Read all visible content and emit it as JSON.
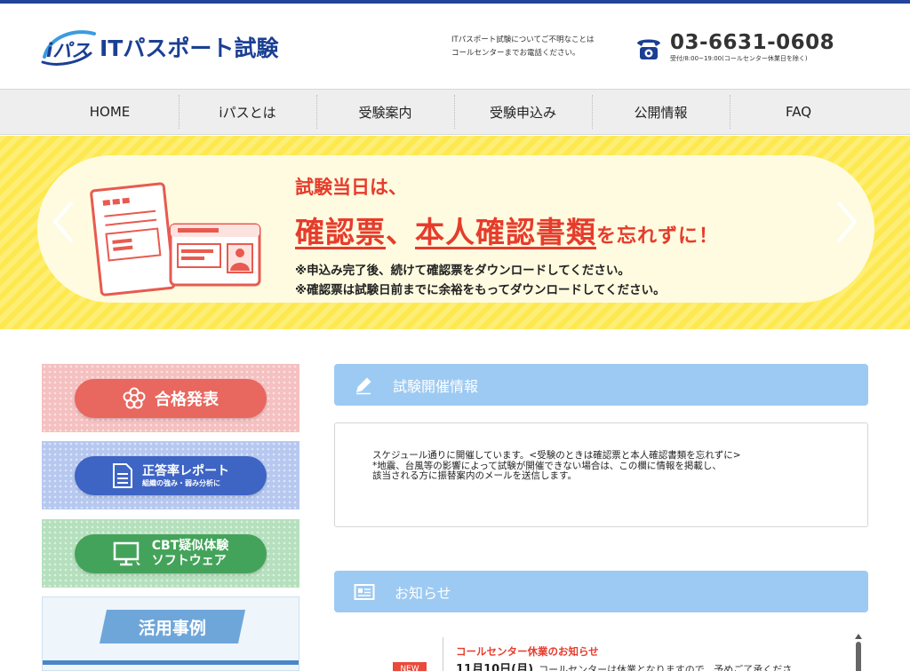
{
  "header": {
    "logo_mark": "iパス",
    "logo_title": "ITパスポート試験",
    "note_lines": [
      "ITパスポート試験についてご不明なことは",
      "コールセンターまでお電話ください。"
    ],
    "tel_number": "03-6631-0608",
    "tel_hours": "受付/8:00~19:00(コールセンター休業日を除く)"
  },
  "nav": {
    "items": [
      {
        "label": "HOME"
      },
      {
        "label": "iパスとは"
      },
      {
        "label": "受験案内"
      },
      {
        "label": "受験申込み"
      },
      {
        "label": "公開情報"
      },
      {
        "label": "FAQ"
      }
    ]
  },
  "banner": {
    "line1": "試験当日は、",
    "big1": "確認票",
    "sep": "、",
    "big2": "本人確認書類",
    "small": "を忘れずに！",
    "note1": "※申込み完了後、続けて確認票をダウンロードしてください。",
    "note2": "※確認票は試験日前までに余裕をもってダウンロードしてください。"
  },
  "sidebar": {
    "results": "合格発表",
    "report_main": "正答率レポート",
    "report_sub": "組織の強み・弱み分析に",
    "cbt_main": "CBT疑似体験",
    "cbt_sub": "ソフトウェア",
    "cases": "活用事例"
  },
  "sections": {
    "exam_info_title": "試験開催情報",
    "exam_info_lines": [
      "スケジュール通りに開催しています。<受験のときは確認票と本人確認書類を忘れずに>",
      "*地震、台風等の影響によって試験が開催できない場合は、この欄に情報を掲載し、",
      "該当される方に振替案内のメールを送信します。"
    ],
    "news_title": "お知らせ"
  },
  "news": {
    "badge": "NEW",
    "item_title": "コールセンター休業のお知らせ",
    "item_date": "11月10日(月)",
    "item_text": "コールセンターは休業となりますので、予めご了承くださ"
  },
  "colors": {
    "brand_navy": "#1b3f93",
    "banner_yellow": "#fde94f",
    "accent_red": "#e63c2c",
    "section_blue": "#9dcaf2"
  }
}
